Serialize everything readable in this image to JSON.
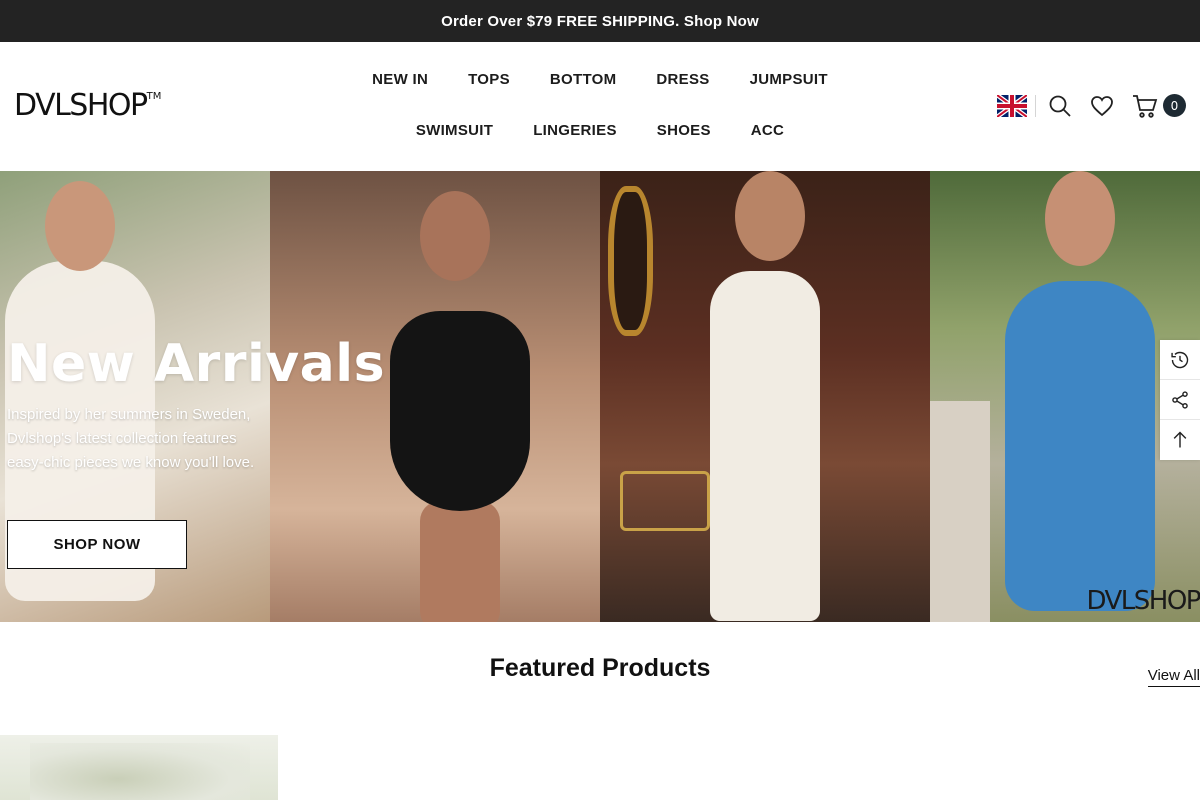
{
  "announcement": {
    "text": "Order Over $79 FREE SHIPPING. Shop Now"
  },
  "header": {
    "logo": "DVLSHOP",
    "logo_tm": "TM",
    "nav_row1": [
      "NEW IN",
      "TOPS",
      "BOTTOM",
      "DRESS",
      "JUMPSUIT"
    ],
    "nav_row2": [
      "SWIMSUIT",
      "LINGERIES",
      "SHOES",
      "ACC"
    ],
    "icons": [
      "uk-flag-icon",
      "search-icon",
      "heart-icon",
      "cart-icon"
    ],
    "cart_count": "0"
  },
  "hero": {
    "title": "New Arrivals",
    "subtitle": "Inspired by her summers in Sweden, Dvlshop's latest collection features easy-chic pieces we know you'll love.",
    "button": "SHOP NOW",
    "brand_mark": "DVLSHOP"
  },
  "side_tools": [
    "recently-viewed-icon",
    "share-icon",
    "back-to-top-icon"
  ],
  "featured": {
    "title": "Featured Products",
    "view_all": "View All"
  },
  "colors": {
    "announcement_bg": "#232323",
    "cart_badge_bg": "#1e2a33",
    "text": "#111111"
  }
}
